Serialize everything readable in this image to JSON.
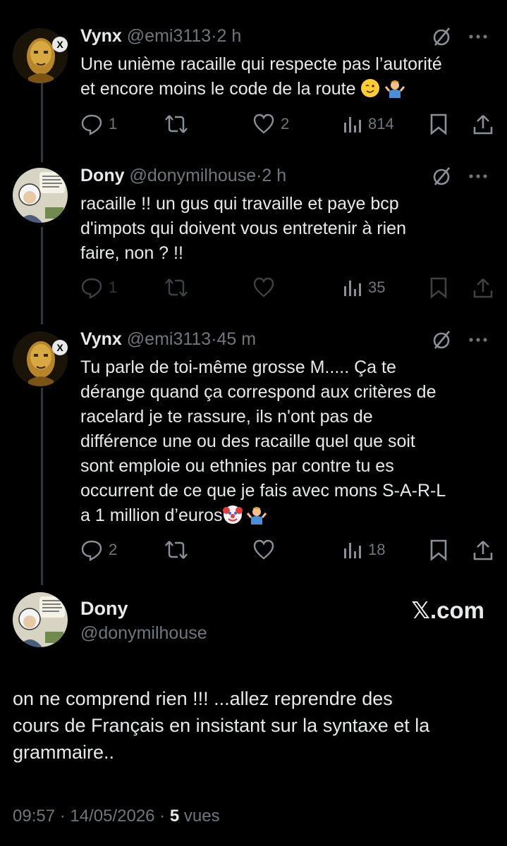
{
  "tweets": [
    {
      "name": "Vynx",
      "handle": "@emi3113",
      "sep": "·",
      "time": "2 h",
      "lines": [
        "Une unième racaille qui respecte pas l’autorité",
        "et encore moins le code de la route"
      ],
      "replies": "1",
      "reposts": "",
      "likes": "2",
      "views": "814"
    },
    {
      "name": "Dony",
      "handle": "@donymilhouse",
      "sep": "·",
      "time": "2 h",
      "lines": [
        "racaille !!  un gus qui travaille et paye bcp",
        "d'impots qui doivent vous entretenir à rien",
        "faire, non ? !!"
      ],
      "replies": "1",
      "reposts": "",
      "likes": "",
      "views": "35"
    },
    {
      "name": "Vynx",
      "handle": "@emi3113",
      "sep": "·",
      "time": "45 m",
      "lines": [
        "Tu parle de toi-même grosse M..... Ça te",
        "dérange quand ça correspond aux critères de",
        "racelard je te rassure, ils n'ont pas de",
        "différence une ou des racaille quel que soit",
        "sont emploie ou ethnies par contre tu es",
        "occurrent de ce que je fais avec mons S-A-R-L",
        "a 1 million d’euros"
      ],
      "replies": "2",
      "reposts": "",
      "likes": "",
      "views": "18"
    }
  ],
  "main": {
    "name": "Dony",
    "handle": "@donymilhouse",
    "watermark": "𝕏.com",
    "lines": [
      "on ne comprend rien !!! ...allez reprendre des",
      "cours de Français en insistant sur la syntaxe et la",
      "grammaire.."
    ],
    "time": "09:57",
    "date": "14/05/2026",
    "views_count": "5",
    "views_label": "vues"
  }
}
